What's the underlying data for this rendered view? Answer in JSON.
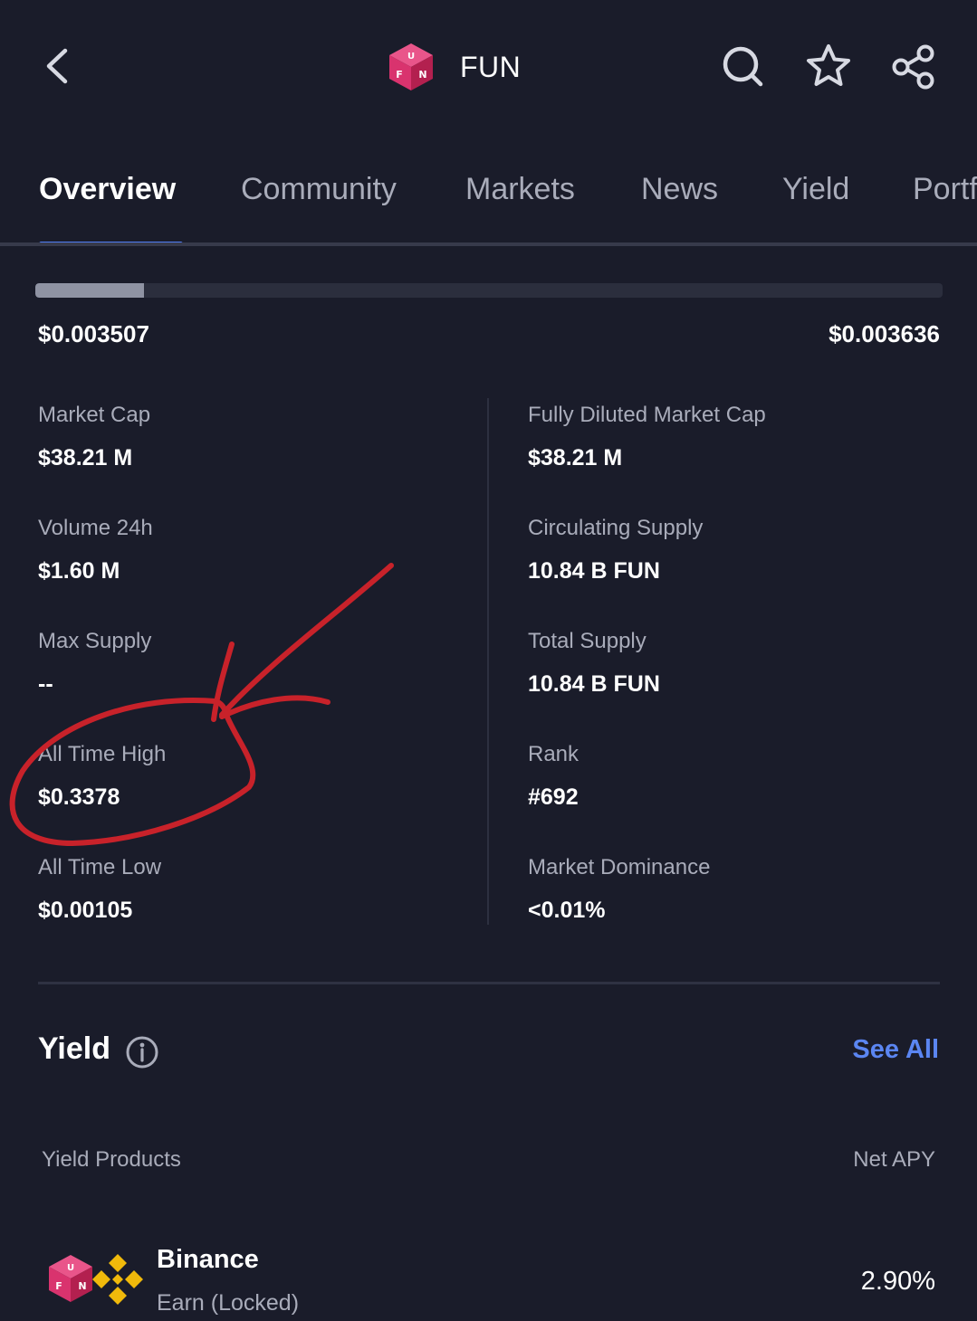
{
  "header": {
    "title": "FUN",
    "logo_letters": [
      "F",
      "U",
      "N"
    ],
    "icons": [
      "back-chevron-icon",
      "search-icon",
      "star-icon",
      "share-icon"
    ]
  },
  "tabs": [
    {
      "label": "Overview",
      "active": true
    },
    {
      "label": "Community",
      "active": false
    },
    {
      "label": "Markets",
      "active": false
    },
    {
      "label": "News",
      "active": false
    },
    {
      "label": "Yield",
      "active": false
    },
    {
      "label": "Portfolio",
      "active": false
    }
  ],
  "price_range": {
    "low": "$0.003507",
    "high": "$0.003636",
    "fill_fraction": 0.12
  },
  "stats": {
    "market_cap": {
      "label": "Market Cap",
      "value": "$38.21 M"
    },
    "fully_diluted_market_cap": {
      "label": "Fully Diluted Market Cap",
      "value": "$38.21 M"
    },
    "volume_24h": {
      "label": "Volume 24h",
      "value": "$1.60 M"
    },
    "circulating_supply": {
      "label": "Circulating Supply",
      "value": "10.84 B FUN"
    },
    "max_supply": {
      "label": "Max Supply",
      "value": "--"
    },
    "total_supply": {
      "label": "Total Supply",
      "value": "10.84 B FUN"
    },
    "all_time_high": {
      "label": "All Time High",
      "value": "$0.3378"
    },
    "rank": {
      "label": "Rank",
      "value": "#692"
    },
    "all_time_low": {
      "label": "All Time Low",
      "value": "$0.00105"
    },
    "market_dominance": {
      "label": "Market Dominance",
      "value": "<0.01%"
    }
  },
  "yield": {
    "title": "Yield",
    "see_all": "See All",
    "col_products": "Yield Products",
    "col_apy": "Net APY",
    "rows": [
      {
        "provider": "Binance",
        "product": "Earn (Locked)",
        "apy": "2.90%"
      }
    ]
  },
  "colors": {
    "background": "#1a1c2a",
    "accent": "#4f7df5",
    "link": "#5b86f2",
    "coin_pink": "#d9336e",
    "binance_yellow": "#f0b90b",
    "annotation_red": "#c8222a"
  }
}
